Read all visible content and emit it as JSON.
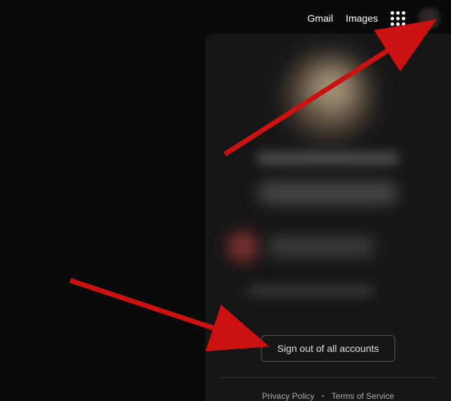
{
  "header": {
    "gmail_label": "Gmail",
    "images_label": "Images"
  },
  "account_panel": {
    "signout_label": "Sign out of all accounts",
    "privacy_label": "Privacy Policy",
    "terms_label": "Terms of Service"
  },
  "annotation": {
    "arrow_color": "#cc1111"
  }
}
